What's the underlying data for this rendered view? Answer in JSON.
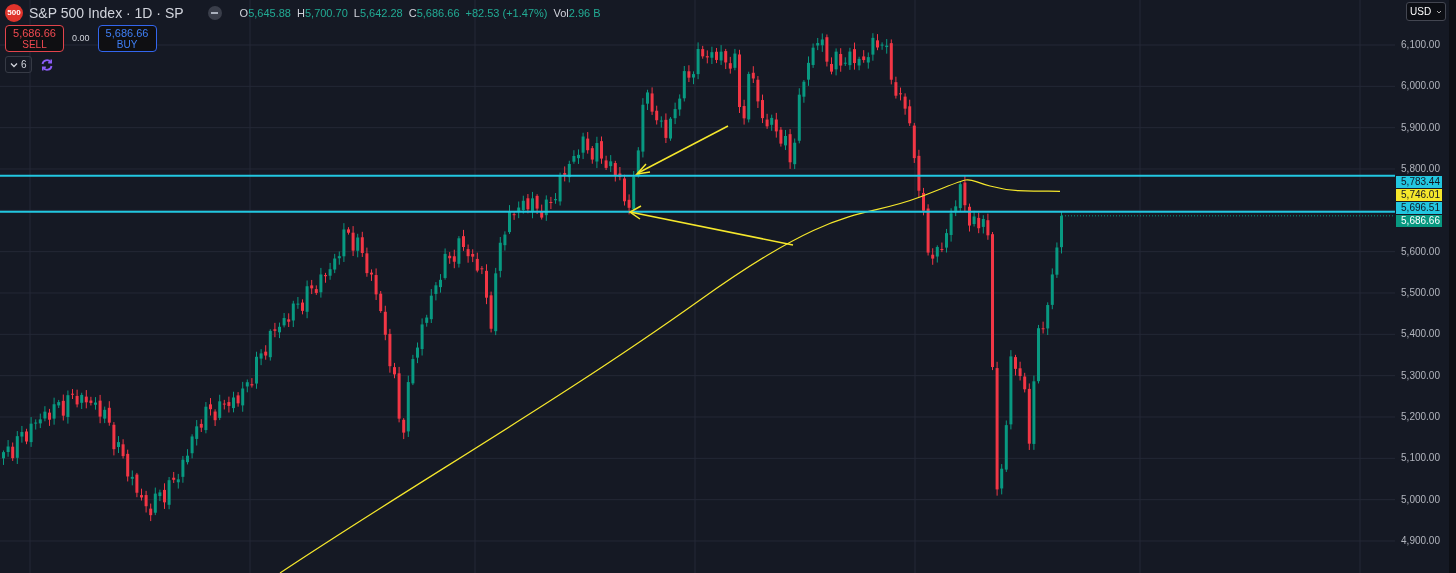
{
  "header": {
    "symbol_badge": "500",
    "title": "S&P 500 Index · 1D · SP",
    "ohlc": [
      {
        "label": "O",
        "value": "5,645.88"
      },
      {
        "label": "H",
        "value": "5,700.70"
      },
      {
        "label": "L",
        "value": "5,642.28"
      },
      {
        "label": "C",
        "value": "5,686.66"
      }
    ],
    "change": "+82.53 (+1.47%)",
    "volume": {
      "label": "Vol",
      "value": "2.96 B"
    }
  },
  "trade": {
    "sell": {
      "price": "5,686.66",
      "label": "SELL"
    },
    "spread": "0.00",
    "buy": {
      "price": "5,686.66",
      "label": "BUY"
    }
  },
  "indicators": {
    "count": "6",
    "expanded": false
  },
  "currency": "USD",
  "price_axis": {
    "ticks": [
      "6,100.00",
      "6,000.00",
      "5,900.00",
      "5,800.00",
      "5,600.00",
      "5,500.00",
      "5,400.00",
      "5,300.00",
      "5,200.00",
      "5,100.00",
      "5,000.00",
      "4,900.00"
    ]
  },
  "price_labels": [
    {
      "value": "5,783.44",
      "kind": "hline",
      "color": "#22c7e0"
    },
    {
      "value": "5,746.01",
      "kind": "ma",
      "color": "#f5e72c"
    },
    {
      "value": "5,696.51",
      "kind": "hline",
      "color": "#22c7e0"
    },
    {
      "value": "5,686.66",
      "kind": "last",
      "color": "#089981"
    }
  ]
}
